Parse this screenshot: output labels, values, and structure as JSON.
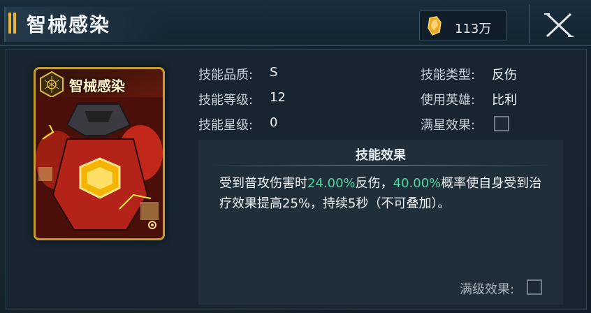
{
  "header": {
    "title": "智械感染",
    "currency_icon": "gold-crystal-icon",
    "currency_value": "113万",
    "close_icon": "close-icon"
  },
  "card": {
    "title": "智械感染",
    "badge_icon": "hex-emblem-icon",
    "corner_icon": "gear-icon"
  },
  "info": {
    "quality_label": "技能品质:",
    "quality_value": "S",
    "level_label": "技能等级:",
    "level_value": "12",
    "star_label": "技能星级:",
    "star_value": "0",
    "type_label": "技能类型:",
    "type_value": "反伤",
    "hero_label": "使用英雄:",
    "hero_value": "比利",
    "full_star_label": "满星效果:"
  },
  "effect": {
    "title": "技能效果",
    "text_1": "受到普攻伤害时",
    "value_1": "24.00%",
    "text_2": "反伤，",
    "value_2": "40.00%",
    "text_3": "概率使自身受到治疗效果提高25%，持续5秒（不可叠加）。",
    "max_label": "满级效果:"
  },
  "colors": {
    "highlight": "#4fd6a3",
    "card_border": "#c99b2e",
    "accent": "#e8b633"
  }
}
